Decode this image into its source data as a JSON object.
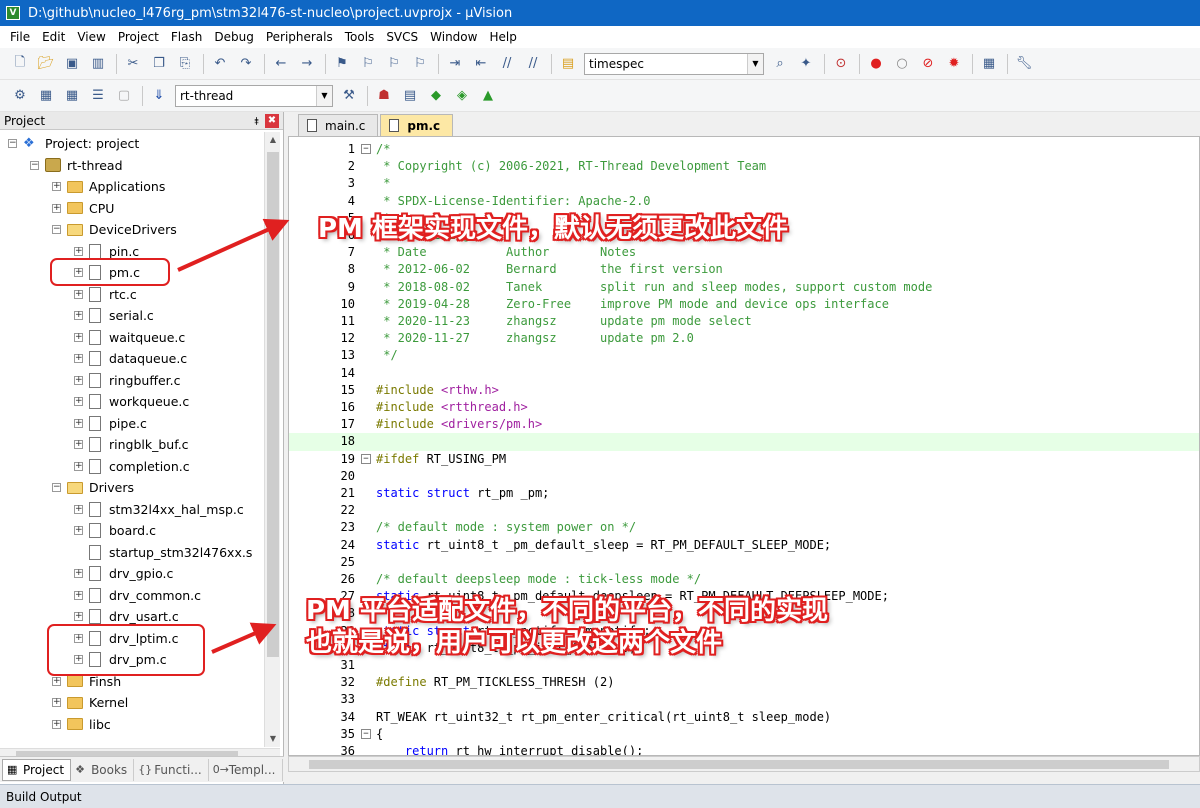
{
  "window": {
    "title": "D:\\github\\nucleo_l476rg_pm\\stm32l476-st-nucleo\\project.uvprojx - µVision"
  },
  "menu": [
    "File",
    "Edit",
    "View",
    "Project",
    "Flash",
    "Debug",
    "Peripherals",
    "Tools",
    "SVCS",
    "Window",
    "Help"
  ],
  "toolbar1": {
    "find_value": "timespec"
  },
  "toolbar2": {
    "target_value": "rt-thread"
  },
  "project_panel": {
    "title": "Project",
    "pin": "⯒",
    "close": "✖",
    "tree": [
      {
        "label": "Project: project",
        "type": "project",
        "exp": "−",
        "level": 0
      },
      {
        "label": "rt-thread",
        "type": "target",
        "exp": "−",
        "level": 1
      },
      {
        "label": "Applications",
        "type": "folder",
        "exp": "+",
        "level": 2
      },
      {
        "label": "CPU",
        "type": "folder",
        "exp": "+",
        "level": 2
      },
      {
        "label": "DeviceDrivers",
        "type": "folder-open",
        "exp": "−",
        "level": 2
      },
      {
        "label": "pin.c",
        "type": "file",
        "exp": "+",
        "level": 3
      },
      {
        "label": "pm.c",
        "type": "file",
        "exp": "+",
        "level": 3
      },
      {
        "label": "rtc.c",
        "type": "file",
        "exp": "+",
        "level": 3
      },
      {
        "label": "serial.c",
        "type": "file",
        "exp": "+",
        "level": 3
      },
      {
        "label": "waitqueue.c",
        "type": "file",
        "exp": "+",
        "level": 3
      },
      {
        "label": "dataqueue.c",
        "type": "file",
        "exp": "+",
        "level": 3
      },
      {
        "label": "ringbuffer.c",
        "type": "file",
        "exp": "+",
        "level": 3
      },
      {
        "label": "workqueue.c",
        "type": "file",
        "exp": "+",
        "level": 3
      },
      {
        "label": "pipe.c",
        "type": "file",
        "exp": "+",
        "level": 3
      },
      {
        "label": "ringblk_buf.c",
        "type": "file",
        "exp": "+",
        "level": 3
      },
      {
        "label": "completion.c",
        "type": "file",
        "exp": "+",
        "level": 3
      },
      {
        "label": "Drivers",
        "type": "folder-open",
        "exp": "−",
        "level": 2
      },
      {
        "label": "stm32l4xx_hal_msp.c",
        "type": "file",
        "exp": "+",
        "level": 3
      },
      {
        "label": "board.c",
        "type": "file",
        "exp": "+",
        "level": 3
      },
      {
        "label": "startup_stm32l476xx.s",
        "type": "file",
        "exp": "",
        "level": 3
      },
      {
        "label": "drv_gpio.c",
        "type": "file",
        "exp": "+",
        "level": 3
      },
      {
        "label": "drv_common.c",
        "type": "file",
        "exp": "+",
        "level": 3
      },
      {
        "label": "drv_usart.c",
        "type": "file",
        "exp": "+",
        "level": 3
      },
      {
        "label": "drv_lptim.c",
        "type": "file",
        "exp": "+",
        "level": 3
      },
      {
        "label": "drv_pm.c",
        "type": "file",
        "exp": "+",
        "level": 3
      },
      {
        "label": "Finsh",
        "type": "folder",
        "exp": "+",
        "level": 2
      },
      {
        "label": "Kernel",
        "type": "folder",
        "exp": "+",
        "level": 2
      },
      {
        "label": "libc",
        "type": "folder",
        "exp": "+",
        "level": 2
      }
    ],
    "tabs": [
      {
        "label": "Project",
        "icon": "▦",
        "active": true
      },
      {
        "label": "Books",
        "icon": "❖",
        "active": false
      },
      {
        "label": "Functi...",
        "icon": "{}",
        "active": false
      },
      {
        "label": "Templ...",
        "icon": "0→",
        "active": false
      }
    ]
  },
  "editor": {
    "tabs": [
      {
        "label": "main.c",
        "active": false
      },
      {
        "label": "pm.c",
        "active": true
      }
    ],
    "lines": [
      {
        "n": "1",
        "fold": "−",
        "parts": [
          [
            "cm",
            "/*"
          ]
        ]
      },
      {
        "n": "2",
        "parts": [
          [
            "cm",
            " * Copyright (c) 2006-2021, RT-Thread Development Team"
          ]
        ]
      },
      {
        "n": "3",
        "parts": [
          [
            "cm",
            " *"
          ]
        ]
      },
      {
        "n": "4",
        "parts": [
          [
            "cm",
            " * SPDX-License-Identifier: Apache-2.0"
          ]
        ]
      },
      {
        "n": "5",
        "parts": [
          [
            "cm",
            " *"
          ]
        ]
      },
      {
        "n": "6",
        "parts": [
          [
            "cm",
            " * Change Logs:"
          ]
        ]
      },
      {
        "n": "7",
        "parts": [
          [
            "cm",
            " * Date           Author       Notes"
          ]
        ]
      },
      {
        "n": "8",
        "parts": [
          [
            "cm",
            " * 2012-06-02     Bernard      the first version"
          ]
        ]
      },
      {
        "n": "9",
        "parts": [
          [
            "cm",
            " * 2018-08-02     Tanek        split run and sleep modes, support custom mode"
          ]
        ]
      },
      {
        "n": "10",
        "parts": [
          [
            "cm",
            " * 2019-04-28     Zero-Free    improve PM mode and device ops interface"
          ]
        ]
      },
      {
        "n": "11",
        "parts": [
          [
            "cm",
            " * 2020-11-23     zhangsz      update pm mode select"
          ]
        ]
      },
      {
        "n": "12",
        "parts": [
          [
            "cm",
            " * 2020-11-27     zhangsz      update pm 2.0"
          ]
        ]
      },
      {
        "n": "13",
        "parts": [
          [
            "cm",
            " */"
          ]
        ]
      },
      {
        "n": "14",
        "parts": []
      },
      {
        "n": "15",
        "parts": [
          [
            "pp",
            "#include "
          ],
          [
            "str",
            "<rthw.h>"
          ]
        ]
      },
      {
        "n": "16",
        "parts": [
          [
            "pp",
            "#include "
          ],
          [
            "str",
            "<rtthread.h>"
          ]
        ]
      },
      {
        "n": "17",
        "parts": [
          [
            "pp",
            "#include "
          ],
          [
            "str",
            "<drivers/pm.h>"
          ]
        ]
      },
      {
        "n": "18",
        "current": true,
        "parts": []
      },
      {
        "n": "19",
        "fold": "−",
        "parts": [
          [
            "pp",
            "#ifdef "
          ],
          [
            "tx",
            "RT_USING_PM"
          ]
        ]
      },
      {
        "n": "20",
        "parts": []
      },
      {
        "n": "21",
        "parts": [
          [
            "kw",
            "static struct "
          ],
          [
            "tx",
            "rt_pm _pm;"
          ]
        ]
      },
      {
        "n": "22",
        "parts": []
      },
      {
        "n": "23",
        "parts": [
          [
            "cm",
            "/* default mode : system power on */"
          ]
        ]
      },
      {
        "n": "24",
        "parts": [
          [
            "kw",
            "static "
          ],
          [
            "tx",
            "rt_uint8_t _pm_default_sleep = RT_PM_DEFAULT_SLEEP_MODE;"
          ]
        ]
      },
      {
        "n": "25",
        "parts": []
      },
      {
        "n": "26",
        "parts": [
          [
            "cm",
            "/* default deepsleep mode : tick-less mode */"
          ]
        ]
      },
      {
        "n": "27",
        "parts": [
          [
            "kw",
            "static "
          ],
          [
            "tx",
            "rt_uint8_t _pm_default_deepsleep = RT_PM_DEFAULT_DEEPSLEEP_MODE;"
          ]
        ]
      },
      {
        "n": "28",
        "parts": []
      },
      {
        "n": "29",
        "parts": [
          [
            "kw",
            "static struct "
          ],
          [
            "tx",
            "rt_pm_notify _pm_notify;"
          ]
        ]
      },
      {
        "n": "30",
        "parts": [
          [
            "kw",
            "static "
          ],
          [
            "tx",
            "rt_uint8_t _pm_init_flag = 0;"
          ]
        ]
      },
      {
        "n": "31",
        "parts": []
      },
      {
        "n": "32",
        "parts": [
          [
            "pp",
            "#define "
          ],
          [
            "tx",
            "RT_PM_TICKLESS_THRESH (2)"
          ]
        ]
      },
      {
        "n": "33",
        "parts": []
      },
      {
        "n": "34",
        "parts": [
          [
            "tx",
            "RT_WEAK rt_uint32_t rt_pm_enter_critical(rt_uint8_t sleep_mode)"
          ]
        ]
      },
      {
        "n": "35",
        "fold": "−",
        "parts": [
          [
            "tx",
            "{"
          ]
        ]
      },
      {
        "n": "36",
        "parts": [
          [
            "tx",
            "    "
          ],
          [
            "kw",
            "return "
          ],
          [
            "tx",
            "rt_hw_interrupt_disable();"
          ]
        ]
      }
    ]
  },
  "build_output": {
    "label": "Build Output"
  },
  "annotations": {
    "top": "PM 框架实现文件，默认无须更改此文件",
    "bottom_line1": "PM 平台适配文件，不同的平台，不同的实现",
    "bottom_line2": "也就是说，用户可以更改这两个文件"
  },
  "colors": {
    "title_bar": "#0f67c4",
    "annotation_red": "#e02020",
    "current_line": "#e6ffe6",
    "active_tab": "#fde8a5"
  }
}
